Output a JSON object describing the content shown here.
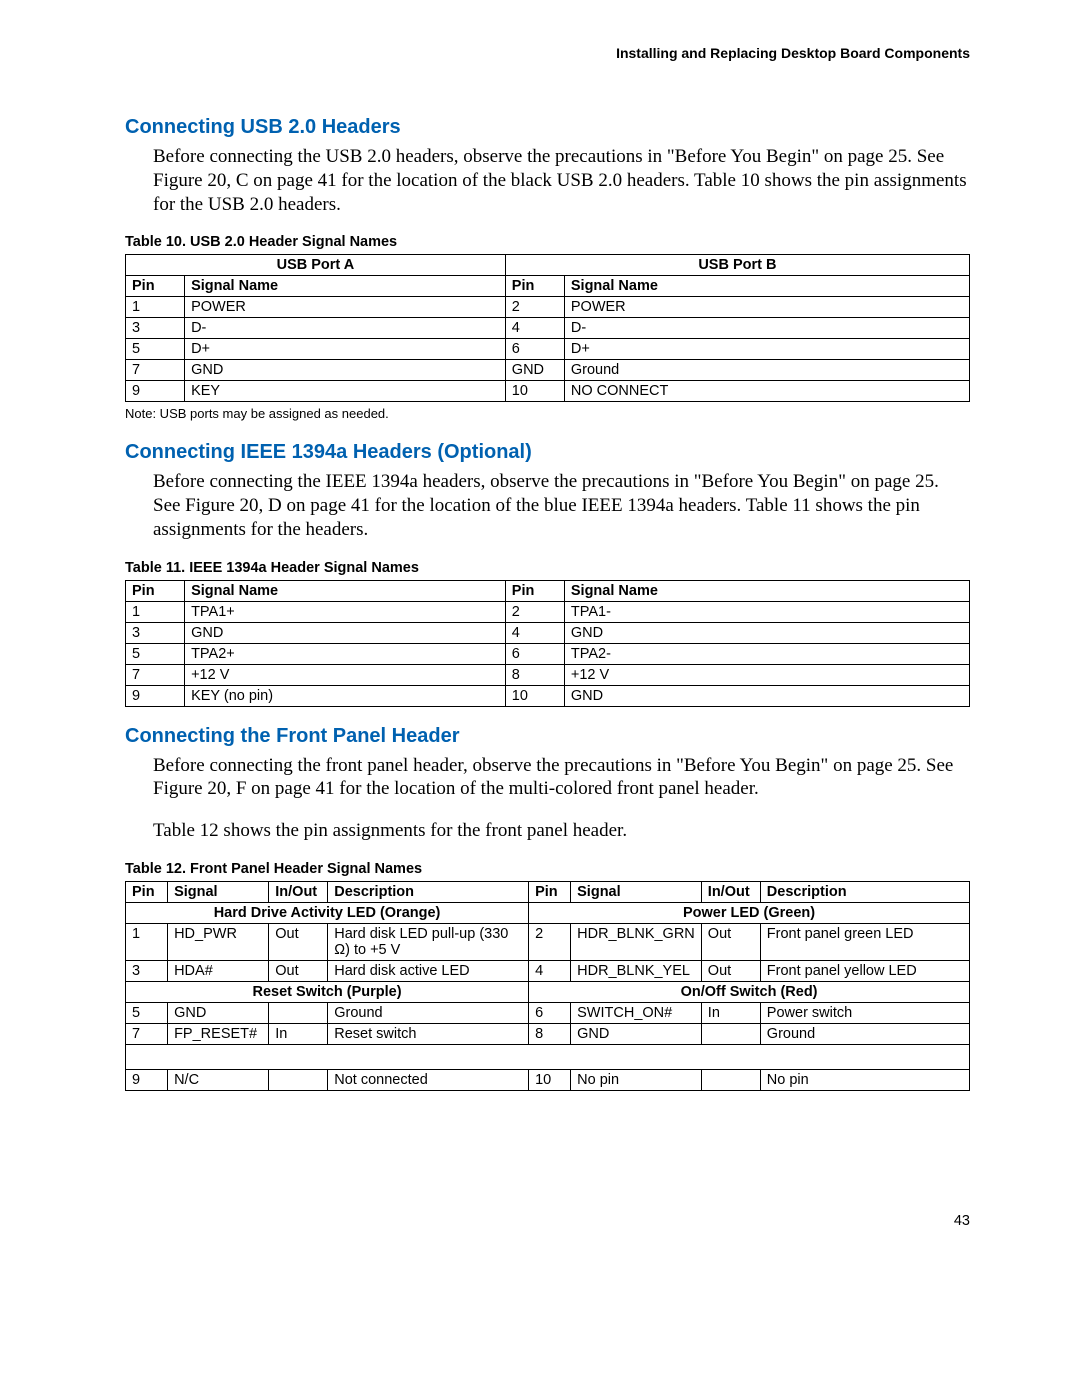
{
  "runningHeader": "Installing and Replacing Desktop Board Components",
  "pageNumber": "43",
  "sections": {
    "usb": {
      "heading": "Connecting USB 2.0 Headers",
      "para": "Before connecting the USB 2.0 headers, observe the precautions in \"Before You Begin\" on page 25.  See Figure 20, C on page 41 for the location of the black USB 2.0 headers.  Table 10 shows the pin assignments for the USB 2.0 headers.",
      "tableCaption": "Table 10.    USB 2.0 Header Signal Names",
      "portA": "USB Port A",
      "portB": "USB Port B",
      "hdrPin": "Pin",
      "hdrSignal": "Signal Name",
      "rows": [
        {
          "p1": "1",
          "s1": "POWER",
          "p2": "2",
          "s2": "POWER"
        },
        {
          "p1": "3",
          "s1": "D-",
          "p2": "4",
          "s2": "D-"
        },
        {
          "p1": "5",
          "s1": "D+",
          "p2": "6",
          "s2": "D+"
        },
        {
          "p1": "7",
          "s1": "GND",
          "p2": "GND",
          "s2": "Ground"
        },
        {
          "p1": "9",
          "s1": "KEY",
          "p2": "10",
          "s2": "NO CONNECT"
        }
      ],
      "note": "Note:  USB ports may be assigned as needed."
    },
    "ieee": {
      "heading": "Connecting IEEE 1394a Headers (Optional)",
      "para": "Before connecting the IEEE 1394a headers, observe the precautions in \"Before You Begin\" on page 25.  See Figure 20, D on page 41 for the location of the blue IEEE 1394a headers.  Table 11 shows the pin assignments for the headers.",
      "tableCaption": "Table 11.    IEEE 1394a Header Signal Names",
      "hdrPin": "Pin",
      "hdrSignal": "Signal Name",
      "rows": [
        {
          "p1": "1",
          "s1": "TPA1+",
          "p2": "2",
          "s2": "TPA1-"
        },
        {
          "p1": "3",
          "s1": "GND",
          "p2": "4",
          "s2": "GND"
        },
        {
          "p1": "5",
          "s1": "TPA2+",
          "p2": "6",
          "s2": "TPA2-"
        },
        {
          "p1": "7",
          "s1": "+12 V",
          "p2": "8",
          "s2": "+12 V"
        },
        {
          "p1": "9",
          "s1": "KEY (no pin)",
          "p2": "10",
          "s2": "GND"
        }
      ]
    },
    "front": {
      "heading": "Connecting the Front Panel Header",
      "para1": "Before connecting the front panel header, observe the precautions in \"Before You Begin\" on page 25.  See Figure 20, F on page 41 for the location of the multi-colored front panel header.",
      "para2": "Table 12 shows the pin assignments for the front panel header.",
      "tableCaption": "Table 12.    Front Panel Header Signal Names",
      "hdr": {
        "pin": "Pin",
        "signal": "Signal",
        "inout": "In/Out",
        "desc": "Description"
      },
      "sub1a": "Hard Drive Activity LED (Orange)",
      "sub1b": "Power LED (Green)",
      "sub2a": "Reset Switch (Purple)",
      "sub2b": "On/Off Switch (Red)",
      "rows1": [
        {
          "p1": "1",
          "s1": "HD_PWR",
          "io1": "Out",
          "d1": "Hard disk LED pull-up (330 Ω) to +5 V",
          "p2": "2",
          "s2": "HDR_BLNK_GRN",
          "io2": "Out",
          "d2": "Front panel green LED"
        },
        {
          "p1": "3",
          "s1": "HDA#",
          "io1": "Out",
          "d1": "Hard disk active LED",
          "p2": "4",
          "s2": "HDR_BLNK_YEL",
          "io2": "Out",
          "d2": "Front panel yellow LED"
        }
      ],
      "rows2": [
        {
          "p1": "5",
          "s1": "GND",
          "io1": "",
          "d1": "Ground",
          "p2": "6",
          "s2": "SWITCH_ON#",
          "io2": "In",
          "d2": "Power switch"
        },
        {
          "p1": "7",
          "s1": "FP_RESET#",
          "io1": "In",
          "d1": "Reset switch",
          "p2": "8",
          "s2": "GND",
          "io2": "",
          "d2": "Ground"
        }
      ],
      "rows3": [
        {
          "p1": "9",
          "s1": "N/C",
          "io1": "",
          "d1": "Not connected",
          "p2": "10",
          "s2": "No pin",
          "io2": "",
          "d2": "No pin"
        }
      ]
    }
  }
}
